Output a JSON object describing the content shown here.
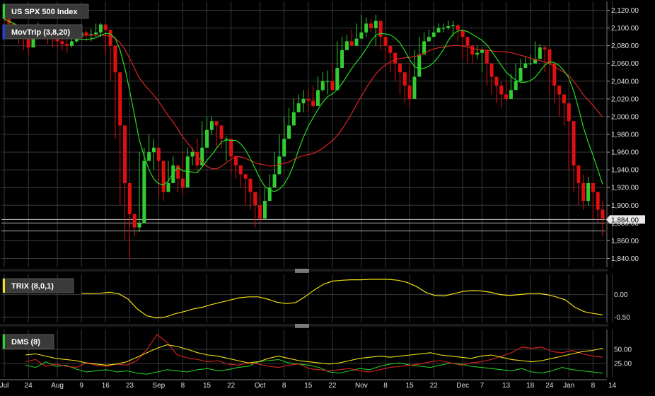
{
  "colors": {
    "background": "#000000",
    "grid": "#3a3a3a",
    "up_candle": "#33cc33",
    "down_candle": "#e01010",
    "fast_ma": "#22dd22",
    "slow_ma": "#dd2222",
    "trix_line": "#f0e010",
    "dms_plus": "#22cc22",
    "dms_minus": "#dd2222",
    "adx": "#f0e010",
    "last_price_box": "#e8e8e8"
  },
  "panels": {
    "price_label": "US SPX 500 Index",
    "ma_label": "MovTrip (3,8,20)",
    "trix_label": "TRIX (8,0,1)",
    "dms_label": "DMS (8)",
    "last_price": "1,884.00"
  },
  "x_axis": {
    "ticks": [
      {
        "label": "Jul",
        "index": 0
      },
      {
        "label": "24",
        "index": 5
      },
      {
        "label": "Aug",
        "index": 11
      },
      {
        "label": "9",
        "index": 16
      },
      {
        "label": "16",
        "index": 21
      },
      {
        "label": "23",
        "index": 26
      },
      {
        "label": "Sep",
        "index": 32
      },
      {
        "label": "8",
        "index": 37
      },
      {
        "label": "15",
        "index": 42
      },
      {
        "label": "22",
        "index": 47
      },
      {
        "label": "Oct",
        "index": 53
      },
      {
        "label": "8",
        "index": 58
      },
      {
        "label": "15",
        "index": 63
      },
      {
        "label": "22",
        "index": 68
      },
      {
        "label": "Nov",
        "index": 74
      },
      {
        "label": "8",
        "index": 79
      },
      {
        "label": "15",
        "index": 84
      },
      {
        "label": "22",
        "index": 89
      },
      {
        "label": "Dec",
        "index": 95
      },
      {
        "label": "7",
        "index": 99
      },
      {
        "label": "13",
        "index": 104
      },
      {
        "label": "18",
        "index": 109
      },
      {
        "label": "24",
        "index": 113
      },
      {
        "label": "Jan",
        "index": 117
      },
      {
        "label": "8",
        "index": 122
      },
      {
        "label": "14",
        "index": 126
      }
    ]
  },
  "chart_data": [
    {
      "type": "candlestick",
      "title": "US SPX 500 Index",
      "ylim": [
        1830,
        2130
      ],
      "y_ticks": [
        1840,
        1860,
        1880,
        1900,
        1920,
        1940,
        1960,
        1980,
        2000,
        2020,
        2040,
        2060,
        2080,
        2100,
        2120
      ],
      "y_tick_labels": [
        "1,840.00",
        "1,860.00",
        "1,880.00",
        "1,900.00",
        "1,920.00",
        "1,940.00",
        "1,960.00",
        "1,980.00",
        "2,000.00",
        "2,020.00",
        "2,040.00",
        "2,060.00",
        "2,080.00",
        "2,100.00",
        "2,120.00"
      ],
      "horizontal_levels": [
        1884,
        1880,
        1871
      ],
      "close": [
        2110,
        2105,
        2100,
        2095,
        2088,
        2078,
        2092,
        2100,
        2098,
        2093,
        2088,
        2085,
        2082,
        2080,
        2085,
        2090,
        2095,
        2092,
        2093,
        2095,
        2104,
        2098,
        2080,
        2050,
        1990,
        1925,
        1890,
        1875,
        1880,
        1950,
        1960,
        1965,
        1950,
        1915,
        1925,
        1945,
        1930,
        1920,
        1955,
        1960,
        1945,
        1965,
        1985,
        1995,
        1990,
        1975,
        1975,
        1955,
        1945,
        1935,
        1930,
        1915,
        1900,
        1885,
        1905,
        1920,
        1935,
        1955,
        1975,
        1990,
        2005,
        2015,
        2020,
        2018,
        2012,
        2030,
        2040,
        2040,
        2030,
        2055,
        2075,
        2085,
        2080,
        2088,
        2095,
        2105,
        2100,
        2108,
        2090,
        2080,
        2072,
        2060,
        2050,
        2035,
        2020,
        2045,
        2070,
        2085,
        2090,
        2095,
        2100,
        2100,
        2102,
        2103,
        2098,
        2090,
        2080,
        2070,
        2072,
        2075,
        2060,
        2045,
        2035,
        2025,
        2020,
        2030,
        2040,
        2055,
        2060,
        2060,
        2065,
        2078,
        2076,
        2060,
        2035,
        2025,
        2015,
        1995,
        1945,
        1925,
        1905,
        1925,
        1915,
        1895,
        1885
      ],
      "high": [
        2118,
        2112,
        2106,
        2101,
        2094,
        2096,
        2100,
        2106,
        2104,
        2098,
        2094,
        2090,
        2088,
        2088,
        2092,
        2098,
        2100,
        2098,
        2099,
        2105,
        2106,
        2104,
        2090,
        2058,
        2000,
        1945,
        1905,
        1890,
        1960,
        1965,
        1980,
        1975,
        1960,
        1935,
        1950,
        1955,
        1945,
        1960,
        1965,
        1965,
        1975,
        1995,
        2000,
        2000,
        1995,
        1985,
        1978,
        1960,
        1950,
        1945,
        1935,
        1920,
        1905,
        1910,
        1920,
        1935,
        1960,
        1980,
        2000,
        2010,
        2020,
        2025,
        2030,
        2030,
        2035,
        2045,
        2050,
        2052,
        2060,
        2085,
        2090,
        2092,
        2098,
        2105,
        2115,
        2112,
        2110,
        2115,
        2100,
        2088,
        2078,
        2065,
        2058,
        2045,
        2060,
        2075,
        2090,
        2095,
        2098,
        2102,
        2105,
        2105,
        2108,
        2108,
        2105,
        2098,
        2090,
        2082,
        2080,
        2078,
        2068,
        2050,
        2045,
        2040,
        2040,
        2048,
        2060,
        2065,
        2068,
        2070,
        2085,
        2082,
        2080,
        2065,
        2045,
        2035,
        2025,
        2000,
        1955,
        1945,
        1935,
        1932,
        1925,
        1910,
        1905
      ],
      "low": [
        2095,
        2090,
        2088,
        2082,
        2075,
        2070,
        2085,
        2092,
        2090,
        2082,
        2078,
        2078,
        2075,
        2072,
        2078,
        2083,
        2088,
        2085,
        2085,
        2090,
        2090,
        2070,
        2040,
        1975,
        1900,
        1860,
        1840,
        1865,
        1870,
        1935,
        1950,
        1940,
        1910,
        1905,
        1915,
        1925,
        1915,
        1912,
        1940,
        1945,
        1938,
        1950,
        1970,
        1980,
        1965,
        1965,
        1950,
        1935,
        1930,
        1920,
        1900,
        1895,
        1875,
        1880,
        1895,
        1910,
        1925,
        1945,
        1965,
        1985,
        1995,
        2005,
        2005,
        2005,
        2010,
        2025,
        2028,
        2025,
        2045,
        2068,
        2075,
        2080,
        2085,
        2090,
        2092,
        2090,
        2095,
        2080,
        2075,
        2065,
        2050,
        2040,
        2025,
        2015,
        2010,
        2040,
        2065,
        2080,
        2085,
        2090,
        2095,
        2095,
        2098,
        2090,
        2085,
        2065,
        2060,
        2060,
        2065,
        2050,
        2035,
        2025,
        2015,
        2010,
        2018,
        2025,
        2045,
        2050,
        2055,
        2058,
        2070,
        2070,
        2050,
        2025,
        2015,
        2000,
        1990,
        1940,
        1915,
        1900,
        1895,
        1900,
        1885,
        1880,
        1865
      ]
    },
    {
      "type": "line",
      "title": "MovTrip (3,8,20)",
      "series": [
        {
          "name": "3",
          "color": "#22dd22"
        },
        {
          "name": "8",
          "color": "#22dd22"
        },
        {
          "name": "20",
          "color": "#dd2222"
        }
      ]
    },
    {
      "type": "line",
      "title": "TRIX (8,0,1)",
      "ylim": [
        -0.62,
        0.45
      ],
      "y_ticks": [
        0.0,
        -0.5
      ],
      "y_tick_labels": [
        "0.00",
        "-0.50"
      ],
      "series": [
        {
          "name": "TRIX",
          "values": [
            0.03,
            0.02,
            0.03,
            0.05,
            0.02,
            -0.1,
            -0.32,
            -0.47,
            -0.52,
            -0.5,
            -0.43,
            -0.38,
            -0.32,
            -0.28,
            -0.22,
            -0.17,
            -0.12,
            -0.07,
            -0.05,
            -0.05,
            -0.1,
            -0.17,
            -0.2,
            -0.18,
            -0.05,
            0.1,
            0.23,
            0.3,
            0.32,
            0.33,
            0.33,
            0.34,
            0.34,
            0.34,
            0.32,
            0.27,
            0.18,
            0.05,
            -0.02,
            -0.03,
            0.02,
            0.07,
            0.09,
            0.08,
            0.05,
            0.0,
            -0.02,
            0.0,
            0.02,
            0.03,
            0.0,
            -0.05,
            -0.12,
            -0.28,
            -0.38,
            -0.42,
            -0.45
          ]
        }
      ]
    },
    {
      "type": "line",
      "title": "DMS (8)",
      "ylim": [
        0,
        85
      ],
      "y_ticks": [
        50,
        25
      ],
      "y_tick_labels": [
        "50.00",
        "25.00"
      ],
      "series": [
        {
          "name": "+DI",
          "values": [
            22,
            18,
            28,
            20,
            22,
            15,
            10,
            12,
            14,
            10,
            12,
            8,
            6,
            10,
            14,
            12,
            10,
            14,
            16,
            12,
            14,
            18,
            20,
            28,
            30,
            32,
            26,
            24,
            22,
            18,
            10,
            8,
            12,
            16,
            14,
            20,
            24,
            26,
            22,
            20,
            18,
            22,
            26,
            24,
            20,
            18,
            16,
            14,
            12,
            16,
            10,
            8,
            12,
            18,
            14,
            12,
            10,
            8
          ]
        },
        {
          "name": "-DI",
          "values": [
            28,
            32,
            20,
            24,
            20,
            18,
            26,
            22,
            20,
            24,
            22,
            30,
            50,
            76,
            62,
            40,
            35,
            32,
            28,
            30,
            24,
            22,
            26,
            24,
            20,
            18,
            22,
            24,
            16,
            14,
            12,
            14,
            16,
            12,
            10,
            14,
            18,
            20,
            22,
            24,
            28,
            30,
            26,
            22,
            26,
            28,
            32,
            38,
            44,
            54,
            52,
            54,
            46,
            44,
            48,
            42,
            38,
            36
          ]
        },
        {
          "name": "ADX",
          "values": [
            40,
            42,
            38,
            34,
            32,
            30,
            26,
            24,
            22,
            24,
            28,
            36,
            44,
            52,
            58,
            55,
            50,
            44,
            40,
            38,
            34,
            30,
            26,
            28,
            34,
            38,
            34,
            30,
            28,
            26,
            24,
            26,
            30,
            34,
            36,
            38,
            36,
            38,
            40,
            42,
            44,
            40,
            38,
            36,
            34,
            38,
            40,
            36,
            32,
            30,
            28,
            30,
            34,
            38,
            42,
            46,
            48,
            52
          ]
        }
      ]
    }
  ]
}
